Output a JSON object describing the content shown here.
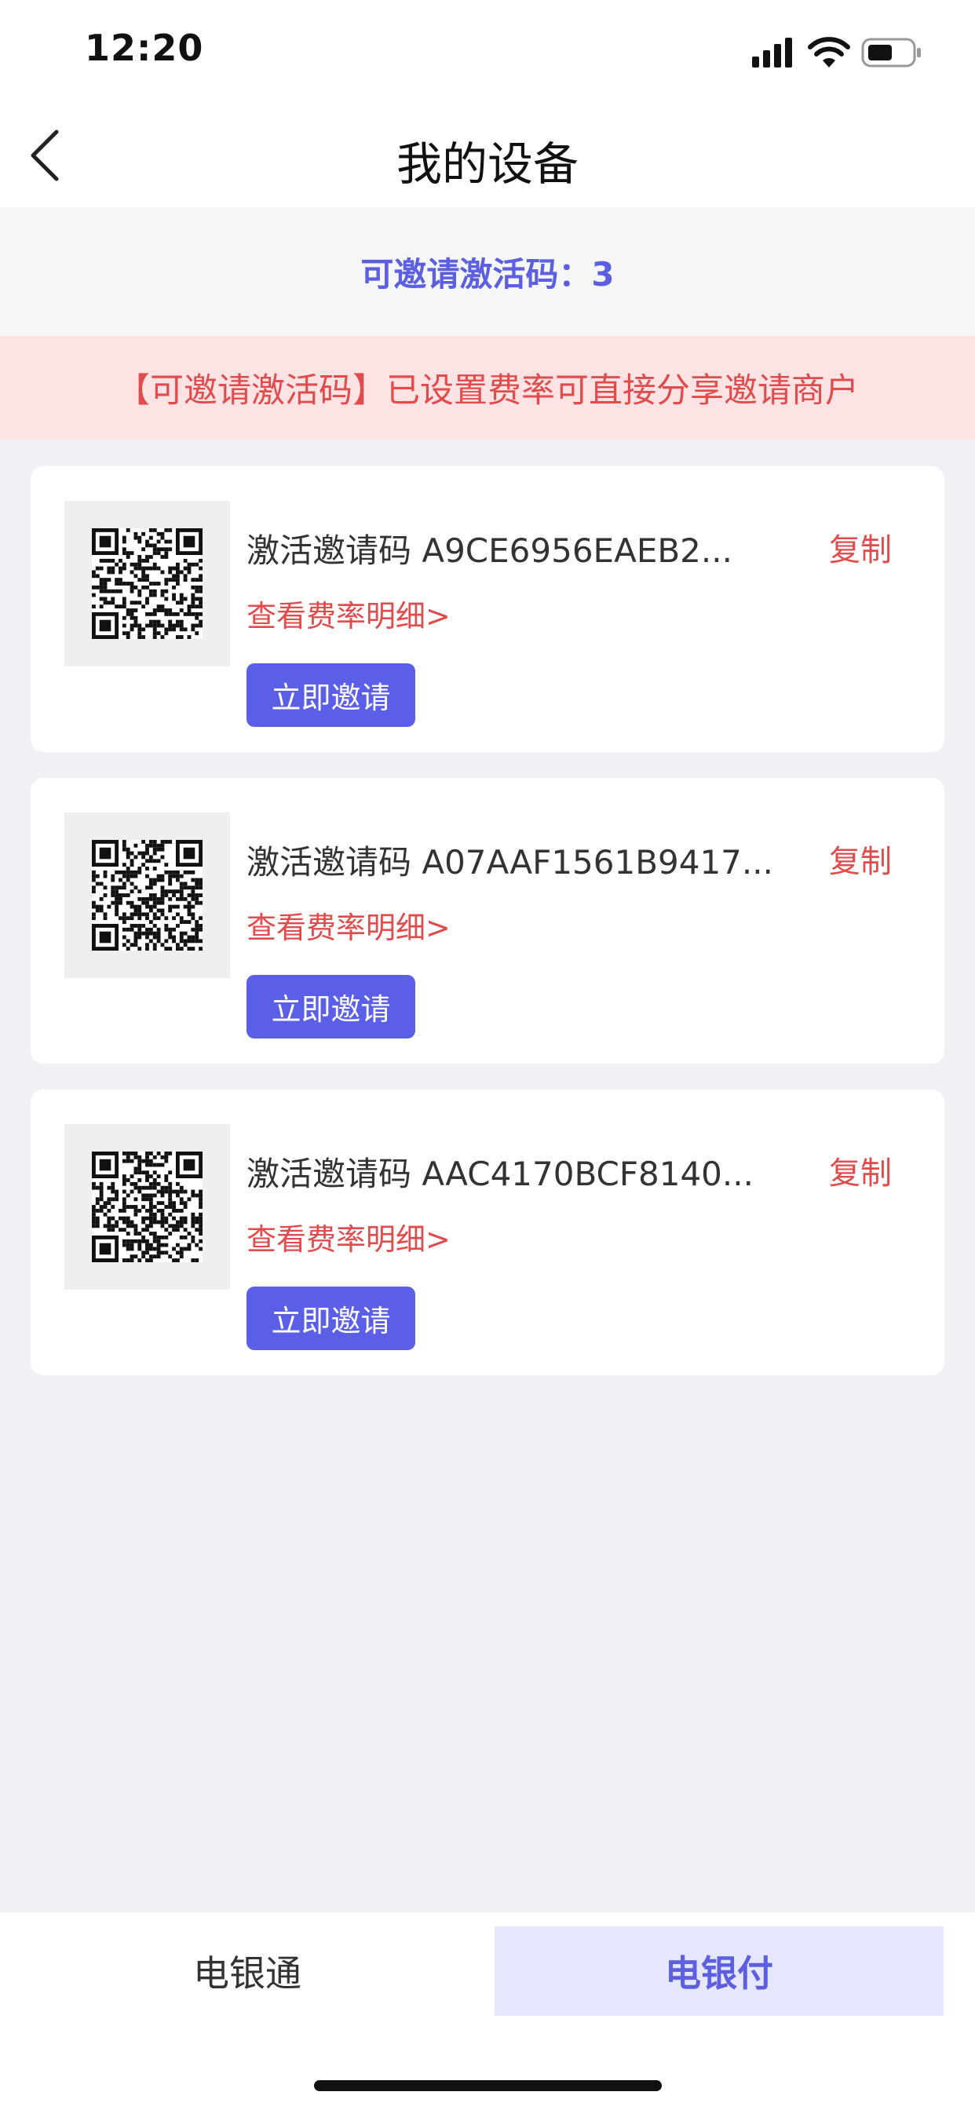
{
  "status": {
    "time": "12:20"
  },
  "nav": {
    "title": "我的设备"
  },
  "invite_count": {
    "text": "可邀请激活码：3"
  },
  "notice": {
    "text": "【可邀请激活码】已设置费率可直接分享邀请商户"
  },
  "cards": [
    {
      "code": "激活邀请码 A9CE6956EAEB2...",
      "copy": "复制",
      "rate": "查看费率明细>",
      "button": "立即邀请"
    },
    {
      "code": "激活邀请码 A07AAF1561B9417...",
      "copy": "复制",
      "rate": "查看费率明细>",
      "button": "立即邀请"
    },
    {
      "code": "激活邀请码 AAC4170BCF8140...",
      "copy": "复制",
      "rate": "查看费率明细>",
      "button": "立即邀请"
    }
  ],
  "tabs": [
    {
      "label": "电银通",
      "active": false
    },
    {
      "label": "电银付",
      "active": true
    }
  ],
  "colors": {
    "accent": "#5b5fe0",
    "danger": "#e24b4b",
    "notice_bg": "#fde3e3",
    "active_tab_bg": "#e6e6fd"
  },
  "icons": [
    "signal-icon",
    "wifi-icon",
    "battery-icon",
    "back-chevron-icon",
    "qr-code-icon"
  ]
}
